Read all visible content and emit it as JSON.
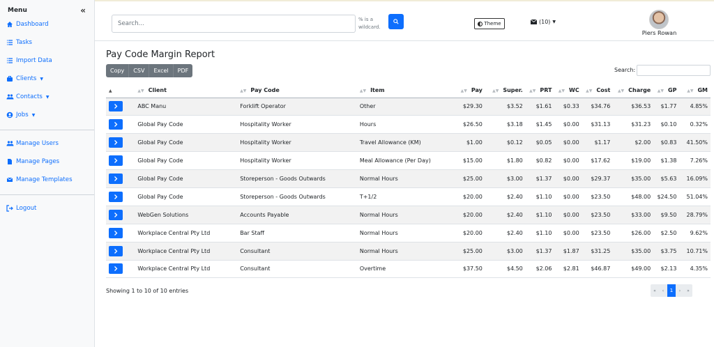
{
  "sidebar": {
    "title": "Menu",
    "collapse_icon": "double-chevron-left-icon",
    "items": [
      {
        "label": "Dashboard",
        "icon": "home-icon"
      },
      {
        "label": "Tasks",
        "icon": "list-icon"
      },
      {
        "label": "Import Data",
        "icon": "list-icon"
      },
      {
        "label": "Clients",
        "icon": "briefcase-icon",
        "dropdown": true
      },
      {
        "label": "Contacts",
        "icon": "users-icon",
        "dropdown": true
      },
      {
        "label": "Jobs",
        "icon": "user-circle-icon",
        "dropdown": true
      }
    ],
    "admin_items": [
      {
        "label": "Manage Users",
        "icon": "users-icon"
      },
      {
        "label": "Manage Pages",
        "icon": "file-icon"
      },
      {
        "label": "Manage Templates",
        "icon": "envelope-icon"
      }
    ],
    "logout": {
      "label": "Logout",
      "icon": "sign-out-icon"
    }
  },
  "header": {
    "search_placeholder": "Search...",
    "wildcard_note": "% is a wildcard.",
    "theme_label": "Theme",
    "mail_count": "(10)",
    "user_name": "Piers Rowan"
  },
  "report": {
    "title": "Pay Code Margin Report",
    "exports": [
      "Copy",
      "CSV",
      "Excel",
      "PDF"
    ],
    "search_label": "Search:",
    "columns": [
      "Client",
      "Pay Code",
      "Item",
      "Pay",
      "Super.",
      "PRT",
      "WC",
      "Cost",
      "Charge",
      "GP",
      "GM"
    ],
    "rows": [
      [
        "ABC Manu",
        "Forklift Operator",
        "Other",
        "$29.30",
        "$3.52",
        "$1.61",
        "$0.33",
        "$34.76",
        "$36.53",
        "$1.77",
        "4.85%"
      ],
      [
        "Global Pay Code",
        "Hospitality Worker",
        "Hours",
        "$26.50",
        "$3.18",
        "$1.45",
        "$0.00",
        "$31.13",
        "$31.23",
        "$0.10",
        "0.32%"
      ],
      [
        "Global Pay Code",
        "Hospitality Worker",
        "Travel Allowance (KM)",
        "$1.00",
        "$0.12",
        "$0.05",
        "$0.00",
        "$1.17",
        "$2.00",
        "$0.83",
        "41.50%"
      ],
      [
        "Global Pay Code",
        "Hospitality Worker",
        "Meal Allowance (Per Day)",
        "$15.00",
        "$1.80",
        "$0.82",
        "$0.00",
        "$17.62",
        "$19.00",
        "$1.38",
        "7.26%"
      ],
      [
        "Global Pay Code",
        "Storeperson - Goods Outwards",
        "Normal Hours",
        "$25.00",
        "$3.00",
        "$1.37",
        "$0.00",
        "$29.37",
        "$35.00",
        "$5.63",
        "16.09%"
      ],
      [
        "Global Pay Code",
        "Storeperson - Goods Outwards",
        "T+1/2",
        "$20.00",
        "$2.40",
        "$1.10",
        "$0.00",
        "$23.50",
        "$48.00",
        "$24.50",
        "51.04%"
      ],
      [
        "WebGen Solutions",
        "Accounts Payable",
        "Normal Hours",
        "$20.00",
        "$2.40",
        "$1.10",
        "$0.00",
        "$23.50",
        "$33.00",
        "$9.50",
        "28.79%"
      ],
      [
        "Workplace Central Pty Ltd",
        "Bar Staff",
        "Normal Hours",
        "$20.00",
        "$2.40",
        "$1.10",
        "$0.00",
        "$23.50",
        "$26.00",
        "$2.50",
        "9.62%"
      ],
      [
        "Workplace Central Pty Ltd",
        "Consultant",
        "Normal Hours",
        "$25.00",
        "$3.00",
        "$1.37",
        "$1.87",
        "$31.25",
        "$35.00",
        "$3.75",
        "10.71%"
      ],
      [
        "Workplace Central Pty Ltd",
        "Consultant",
        "Overtime",
        "$37.50",
        "$4.50",
        "$2.06",
        "$2.81",
        "$46.87",
        "$49.00",
        "$2.13",
        "4.35%"
      ]
    ],
    "info": "Showing 1 to 10 of 10 entries",
    "pagination": [
      "«",
      "‹",
      "1",
      "›",
      "»"
    ],
    "current_page": "1"
  },
  "colors": {
    "accent": "#0d6efd",
    "export_bg": "#6c757d",
    "stripe": "#f2f2f2"
  }
}
